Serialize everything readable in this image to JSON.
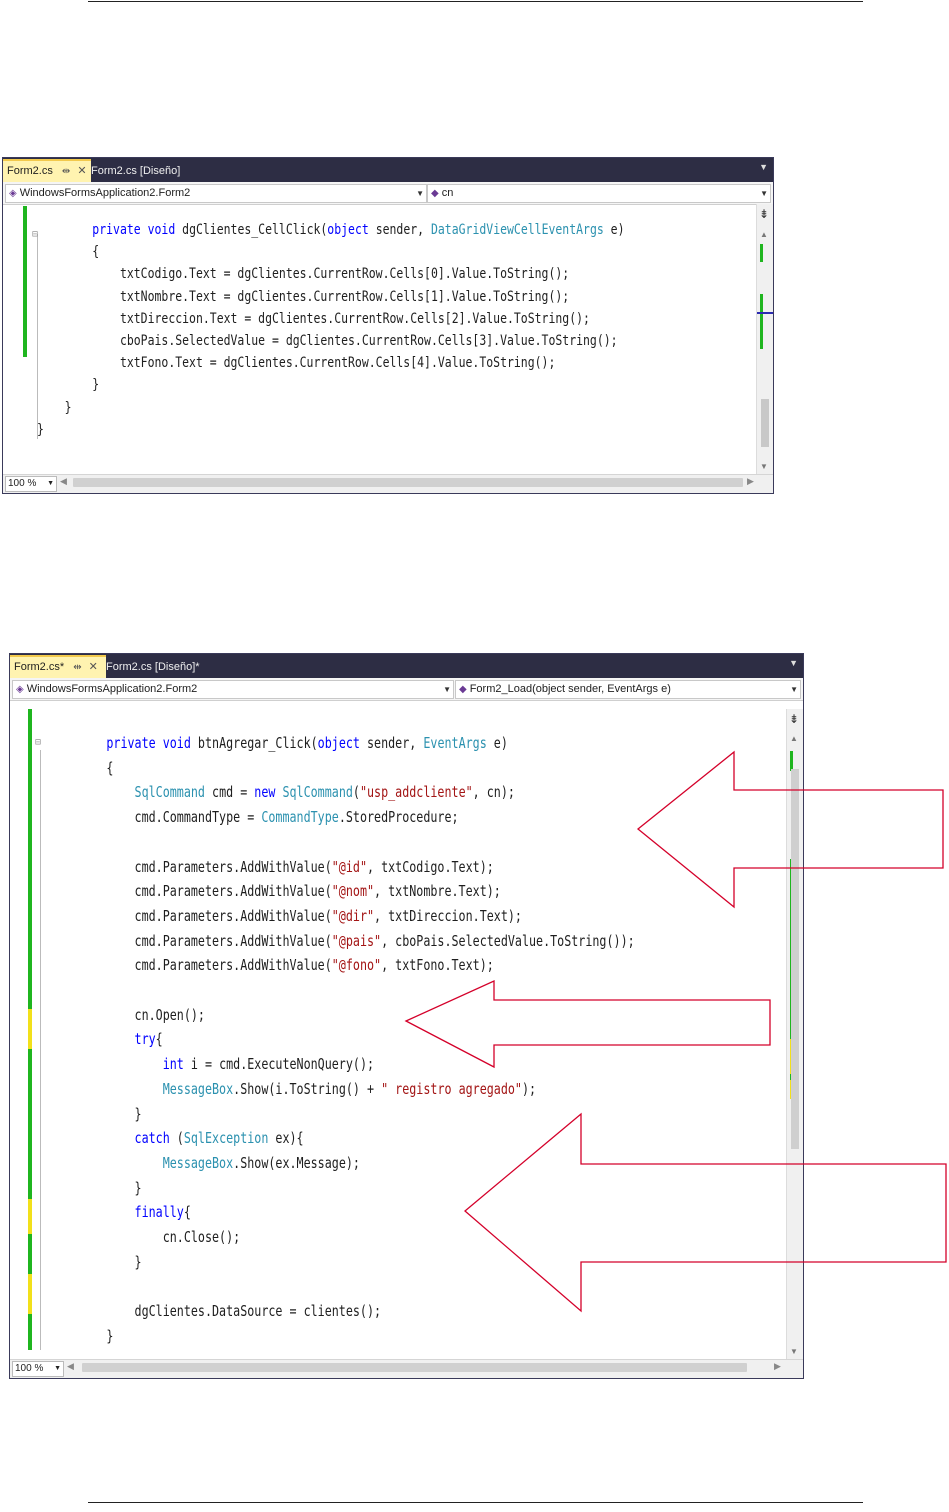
{
  "screenshot1": {
    "tabs": [
      {
        "label": "Form2.cs",
        "pin": "⇹",
        "close": "✕"
      },
      {
        "label": "Form2.cs [Diseño]"
      }
    ],
    "nav_left": "WindowsFormsApplication2.Form2",
    "nav_right": "cn",
    "zoom": "100 %",
    "code": [
      [
        "        ",
        [
          "kw",
          "private void"
        ],
        " dgClientes_CellClick(",
        [
          "kw",
          "object"
        ],
        " sender, ",
        [
          "ty",
          "DataGridViewCellEventArgs"
        ],
        " e)"
      ],
      [
        "        {"
      ],
      [
        "            txtCodigo.Text = dgClientes.CurrentRow.Cells[0].Value.ToString();"
      ],
      [
        "            txtNombre.Text = dgClientes.CurrentRow.Cells[1].Value.ToString();"
      ],
      [
        "            txtDireccion.Text = dgClientes.CurrentRow.Cells[2].Value.ToString();"
      ],
      [
        "            cboPais.SelectedValue = dgClientes.CurrentRow.Cells[3].Value.ToString();"
      ],
      [
        "            txtFono.Text = dgClientes.CurrentRow.Cells[4].Value.ToString();"
      ],
      [
        "        }"
      ],
      [
        "    }"
      ],
      [
        "}"
      ]
    ]
  },
  "screenshot2": {
    "tabs": [
      {
        "label": "Form2.cs*",
        "pin": "⇹",
        "close": "✕"
      },
      {
        "label": "Form2.cs [Diseño]*"
      }
    ],
    "nav_left": "WindowsFormsApplication2.Form2",
    "nav_right": "Form2_Load(object sender, EventArgs e)",
    "zoom": "100 %",
    "code": [
      [
        "        ",
        [
          "kw",
          "private void"
        ],
        " btnAgregar_Click(",
        [
          "kw",
          "object"
        ],
        " sender, ",
        [
          "ty",
          "EventArgs"
        ],
        " e)"
      ],
      [
        "        {"
      ],
      [
        "            ",
        [
          "ty",
          "SqlCommand"
        ],
        " cmd = ",
        [
          "kw",
          "new"
        ],
        " ",
        [
          "ty",
          "SqlCommand"
        ],
        "(",
        [
          "str",
          "\"usp_addcliente\""
        ],
        ", cn);"
      ],
      [
        "            cmd.CommandType = ",
        [
          "ty",
          "CommandType"
        ],
        ".StoredProcedure;"
      ],
      [
        ""
      ],
      [
        "            cmd.Parameters.AddWithValue(",
        [
          "str",
          "\"@id\""
        ],
        ", txtCodigo.Text);"
      ],
      [
        "            cmd.Parameters.AddWithValue(",
        [
          "str",
          "\"@nom\""
        ],
        ", txtNombre.Text);"
      ],
      [
        "            cmd.Parameters.AddWithValue(",
        [
          "str",
          "\"@dir\""
        ],
        ", txtDireccion.Text);"
      ],
      [
        "            cmd.Parameters.AddWithValue(",
        [
          "str",
          "\"@pais\""
        ],
        ", cboPais.SelectedValue.ToString());"
      ],
      [
        "            cmd.Parameters.AddWithValue(",
        [
          "str",
          "\"@fono\""
        ],
        ", txtFono.Text);"
      ],
      [
        ""
      ],
      [
        "            cn.Open();"
      ],
      [
        "            ",
        [
          "kw",
          "try"
        ],
        "{"
      ],
      [
        "                ",
        [
          "kw",
          "int"
        ],
        " i = cmd.ExecuteNonQuery();"
      ],
      [
        "                ",
        [
          "ty",
          "MessageBox"
        ],
        ".Show(i.ToString() + ",
        [
          "str",
          "\" registro agregado\""
        ],
        ");"
      ],
      [
        "            }"
      ],
      [
        "            ",
        [
          "kw",
          "catch"
        ],
        " (",
        [
          "ty",
          "SqlException"
        ],
        " ex){"
      ],
      [
        "                ",
        [
          "ty",
          "MessageBox"
        ],
        ".Show(ex.Message);"
      ],
      [
        "            }"
      ],
      [
        "            ",
        [
          "kw",
          "finally"
        ],
        "{"
      ],
      [
        "                cn.Close();"
      ],
      [
        "            }"
      ],
      [
        ""
      ],
      [
        "            dgClientes.DataSource = clientes();"
      ],
      [
        "        }"
      ]
    ]
  },
  "colors": {
    "keyword": "#0000ff",
    "type": "#2b91af",
    "string": "#a31515",
    "arrow": "#d4002a",
    "changed": "#1fb51f",
    "unsaved": "#f2e01a"
  }
}
